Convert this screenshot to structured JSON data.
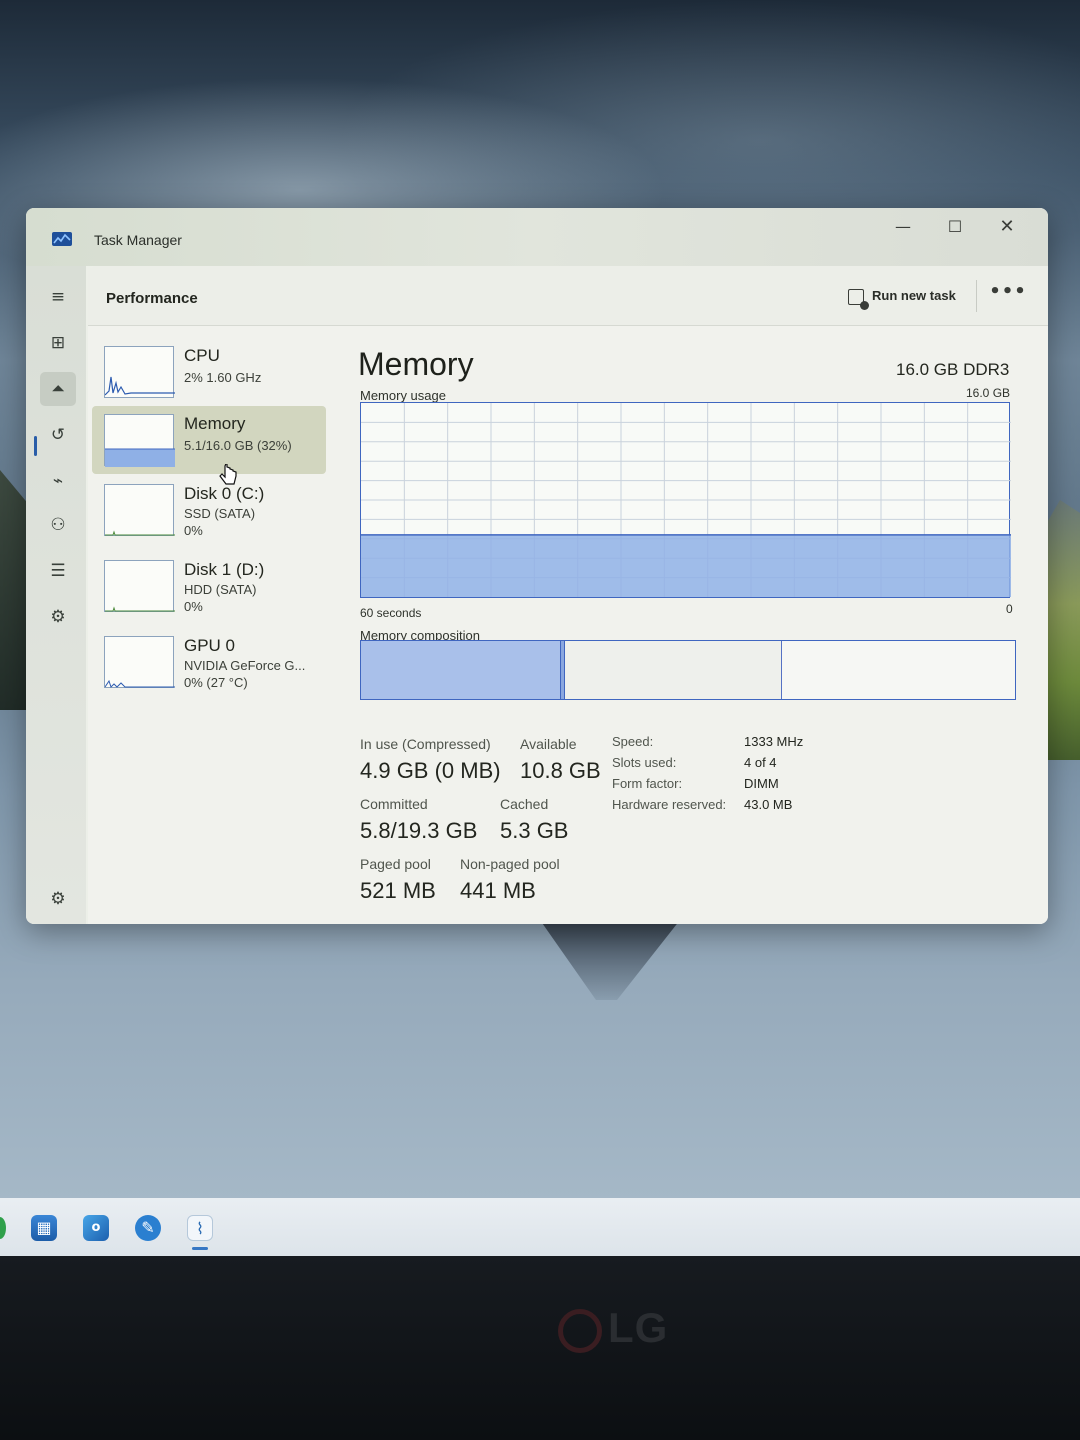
{
  "window": {
    "title": "Task Manager"
  },
  "header": {
    "page_title": "Performance",
    "run_new_task_label": "Run new task",
    "more_label": "•••"
  },
  "nav": [
    {
      "name": "hamburger-icon",
      "glyph": "≡"
    },
    {
      "name": "processes-icon",
      "glyph": "⊞"
    },
    {
      "name": "performance-icon",
      "glyph": "⏶",
      "active": true
    },
    {
      "name": "app-history-icon",
      "glyph": "↺"
    },
    {
      "name": "startup-apps-icon",
      "glyph": "⌁"
    },
    {
      "name": "users-icon",
      "glyph": "⚇"
    },
    {
      "name": "details-icon",
      "glyph": "☰"
    },
    {
      "name": "services-icon",
      "glyph": "⚙"
    },
    {
      "name": "settings-icon",
      "glyph": "⚙"
    }
  ],
  "resources": [
    {
      "name": "CPU",
      "line1": "2%  1.60 GHz",
      "line2": ""
    },
    {
      "name": "Memory",
      "line1": "5.1/16.0 GB (32%)",
      "line2": "",
      "selected": true
    },
    {
      "name": "Disk 0 (C:)",
      "line1": "SSD (SATA)",
      "line2": "0%"
    },
    {
      "name": "Disk 1 (D:)",
      "line1": "HDD (SATA)",
      "line2": "0%"
    },
    {
      "name": "GPU 0",
      "line1": "NVIDIA GeForce G...",
      "line2": "0%  (27 °C)"
    }
  ],
  "detail": {
    "title": "Memory",
    "spec": "16.0 GB DDR3",
    "usage_label": "Memory usage",
    "usage_max": "16.0 GB",
    "time_span": "60 seconds",
    "zero": "0",
    "composition_label": "Memory composition",
    "usage_fraction": 0.32,
    "composition": {
      "in_use": 4.9,
      "modified": 0.1,
      "standby": 5.3,
      "total": 16.0
    }
  },
  "stats": {
    "in_use_label": "In use (Compressed)",
    "in_use_value": "4.9 GB (0 MB)",
    "available_label": "Available",
    "available_value": "10.8 GB",
    "committed_label": "Committed",
    "committed_value": "5.8/19.3 GB",
    "cached_label": "Cached",
    "cached_value": "5.3 GB",
    "paged_label": "Paged pool",
    "paged_value": "521 MB",
    "nonpaged_label": "Non-paged pool",
    "nonpaged_value": "441 MB"
  },
  "properties": [
    {
      "label": "Speed:",
      "value": "1333 MHz"
    },
    {
      "label": "Slots used:",
      "value": "4 of 4"
    },
    {
      "label": "Form factor:",
      "value": "DIMM"
    },
    {
      "label": "Hardware reserved:",
      "value": "43.0 MB"
    }
  ],
  "taskbar": {
    "outlook_glyph": "o",
    "config_glyph": "✎",
    "taskmgr_glyph": "⌇"
  },
  "monitor_brand": "LG",
  "colors": {
    "accent": "#3f66c0",
    "memory_fill": "#8fb0e6",
    "selection": "#d2d6bf"
  }
}
